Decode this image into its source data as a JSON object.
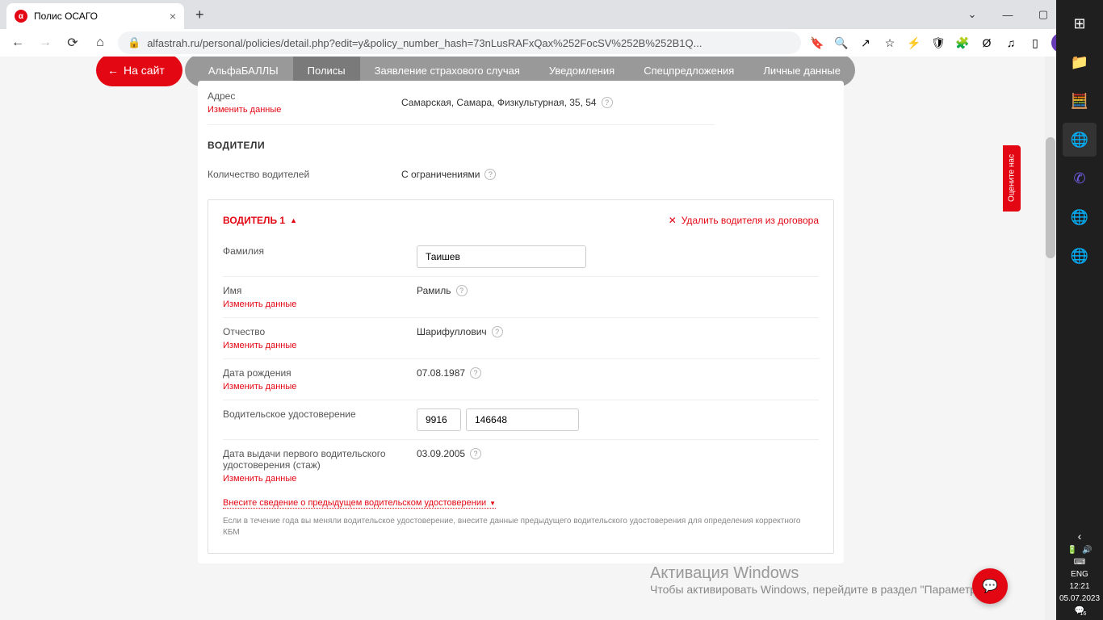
{
  "browser": {
    "tab_title": "Полис ОСАГО",
    "url": "alfastrah.ru/personal/policies/detail.php?edit=y&policy_number_hash=73nLusRAFxQax%252FocSV%252B%252B1Q..."
  },
  "nav": {
    "back_site": "На сайт",
    "items": [
      "АльфаБАЛЛЫ",
      "Полисы",
      "Заявление страхового случая",
      "Уведомления",
      "Спецпредложения",
      "Личные данные"
    ],
    "active_index": 1
  },
  "address_section": {
    "label": "Адрес",
    "value": "Самарская, Самара, Физкультурная, 35, 54",
    "change": "Изменить данные"
  },
  "drivers_section": {
    "title": "ВОДИТЕЛИ",
    "count_label": "Количество водителей",
    "count_value": "С ограничениями"
  },
  "driver": {
    "title": "ВОДИТЕЛЬ 1",
    "remove": "Удалить водителя из договора",
    "surname_label": "Фамилия",
    "surname_value": "Таишев",
    "name_label": "Имя",
    "name_value": "Рамиль",
    "patr_label": "Отчество",
    "patr_value": "Шарифуллович",
    "dob_label": "Дата рождения",
    "dob_value": "07.08.1987",
    "license_label": "Водительское удостоверение",
    "license_series": "9916",
    "license_number": "146648",
    "issue_label": "Дата выдачи первого водительского удостоверения (стаж)",
    "issue_value": "03.09.2005",
    "change": "Изменить данные",
    "prev_license": "Внесите сведение о предыдущем водительском удостоверении",
    "hint": "Если в течение года вы меняли водительское удостоверение, внесите данные предыдущего водительского удостоверения для определения корректного КБМ"
  },
  "feedback": "Оцените нас",
  "windows": {
    "title": "Активация Windows",
    "sub": "Чтобы активировать Windows, перейдите в раздел \"Параметры\"."
  },
  "taskbar": {
    "lang": "ENG",
    "time": "12:21",
    "date": "05.07.2023",
    "notif": "16"
  }
}
